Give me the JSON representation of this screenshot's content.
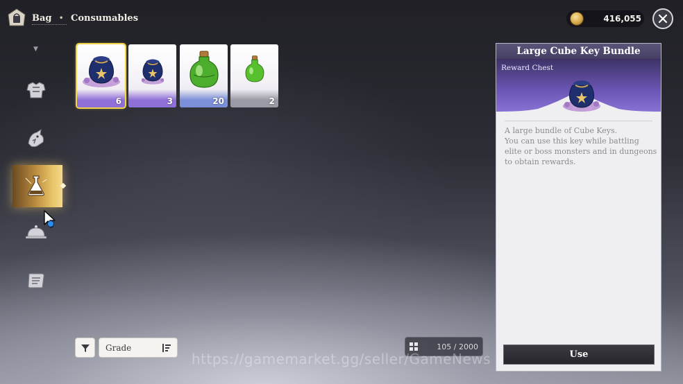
{
  "header": {
    "breadcrumb_root": "Bag",
    "breadcrumb_separator": "•",
    "breadcrumb_current": "Consumables",
    "gold_amount": "416,055",
    "close_icon": "close-icon",
    "bag_icon": "bag-icon"
  },
  "sidebar": {
    "items": [
      {
        "name": "armor",
        "icon": "armor-icon"
      },
      {
        "name": "dragon",
        "icon": "dragon-icon"
      },
      {
        "name": "consumables",
        "icon": "potion-flask-icon",
        "active": true
      },
      {
        "name": "food",
        "icon": "cloche-icon",
        "notification": true
      },
      {
        "name": "scroll",
        "icon": "scroll-icon"
      }
    ]
  },
  "items": [
    {
      "name": "Large Cube Key Bundle",
      "quantity": "6",
      "art": "key-bag-large",
      "grade_color": "#8f6fd8",
      "selected": true
    },
    {
      "name": "Cube Key Bundle",
      "quantity": "3",
      "art": "key-bag-small",
      "grade_color": "#8f6fd8"
    },
    {
      "name": "Large Potion",
      "quantity": "20",
      "art": "potion-large",
      "grade_color": "#7b8fd8"
    },
    {
      "name": "Potion",
      "quantity": "2",
      "art": "potion-small",
      "grade_color": "#9a9aa4"
    }
  ],
  "controls": {
    "filter_icon": "filter-icon",
    "grade_label": "Grade",
    "sort_icon": "sort-icon",
    "capacity": "105 / 2000"
  },
  "detail": {
    "title": "Large Cube Key Bundle",
    "type": "Reward Chest",
    "description_lines": [
      "A large bundle of Cube Keys.",
      "You can use this key while battling",
      "elite or boss monsters and in dungeons",
      "to obtain rewards."
    ],
    "use_label": "Use"
  },
  "watermark": "https://gamemarket.gg/seller/GameNews"
}
